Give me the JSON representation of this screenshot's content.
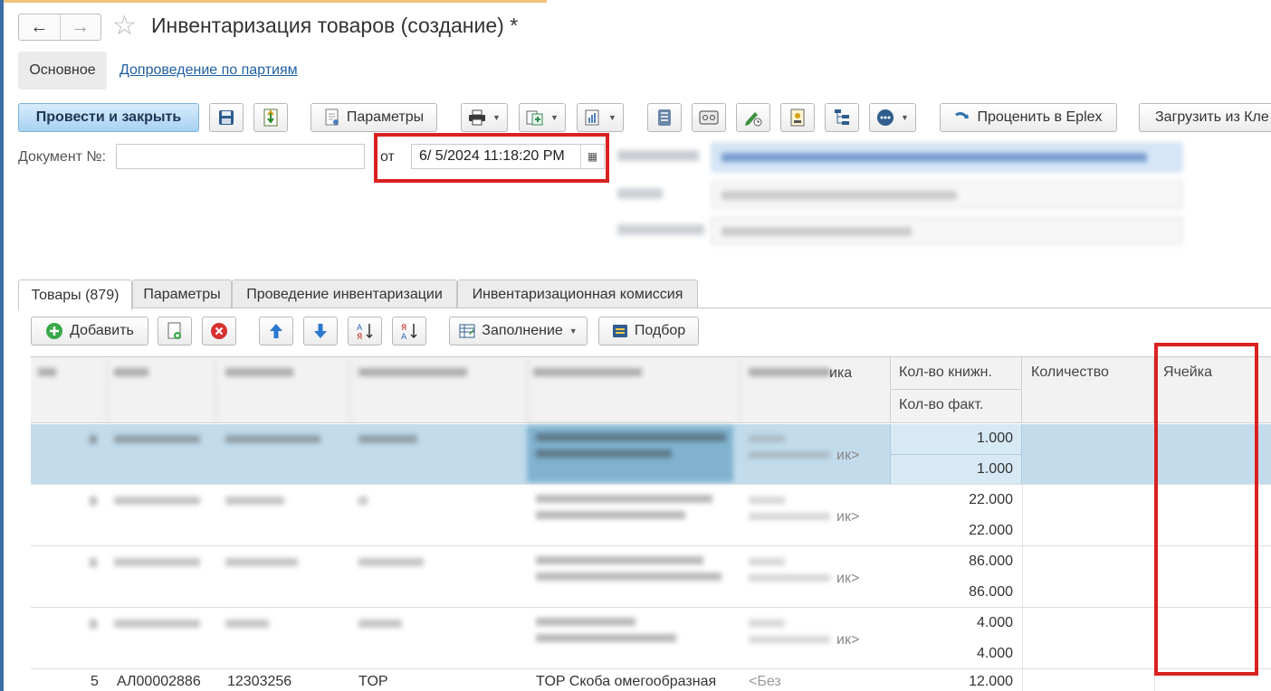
{
  "window": {
    "title": "Инвентаризация товаров (создание) *",
    "nav": {
      "back": "←",
      "forward": "→"
    },
    "favorite_icon": "star-icon"
  },
  "sections": {
    "main": "Основное",
    "link": "Допроведение по партиям"
  },
  "toolbar": {
    "post_close": "Провести и закрыть",
    "parameters": "Параметры",
    "price_eplex": "Проценить в Eplex",
    "load_from": "Загрузить из Кле"
  },
  "header": {
    "doc_number_label": "Документ №:",
    "doc_number_value": "",
    "from_label": "от",
    "date_value": "6/ 5/2024 11:18:20 PM"
  },
  "tabs": [
    {
      "label": "Товары (879)"
    },
    {
      "label": "Параметры"
    },
    {
      "label": "Проведение инвентаризации"
    },
    {
      "label": "Инвентаризационная комиссия"
    }
  ],
  "table_toolbar": {
    "add": "Добавить",
    "fill": "Заполнение",
    "selection": "Подбор"
  },
  "grid": {
    "columns": {
      "characteristic_tail": "ика",
      "qty_book": "Кол-во книжн.",
      "qty_fact": "Кол-во факт.",
      "quantity": "Количество",
      "cell": "Ячейка"
    },
    "rows": [
      {
        "qty_book": "1.000",
        "qty_fact": "1.000",
        "tail": "ик>"
      },
      {
        "qty_book": "22.000",
        "qty_fact": "22.000",
        "tail": "ик>"
      },
      {
        "qty_book": "86.000",
        "qty_fact": "86.000",
        "tail": "ик>"
      },
      {
        "qty_book": "4.000",
        "qty_fact": "4.000",
        "tail": "ик>"
      }
    ],
    "partial_row": {
      "num": "5",
      "code": "АЛ00002886",
      "article": "12303256",
      "brand": "TOP",
      "name": "TOP Скоба омегообразная",
      "characteristic": "<Без",
      "qty_book": "12.000"
    }
  },
  "colors": {
    "accent": "#3b6ea8",
    "highlight": "#d92121",
    "selected_row": "#c2dcec"
  }
}
